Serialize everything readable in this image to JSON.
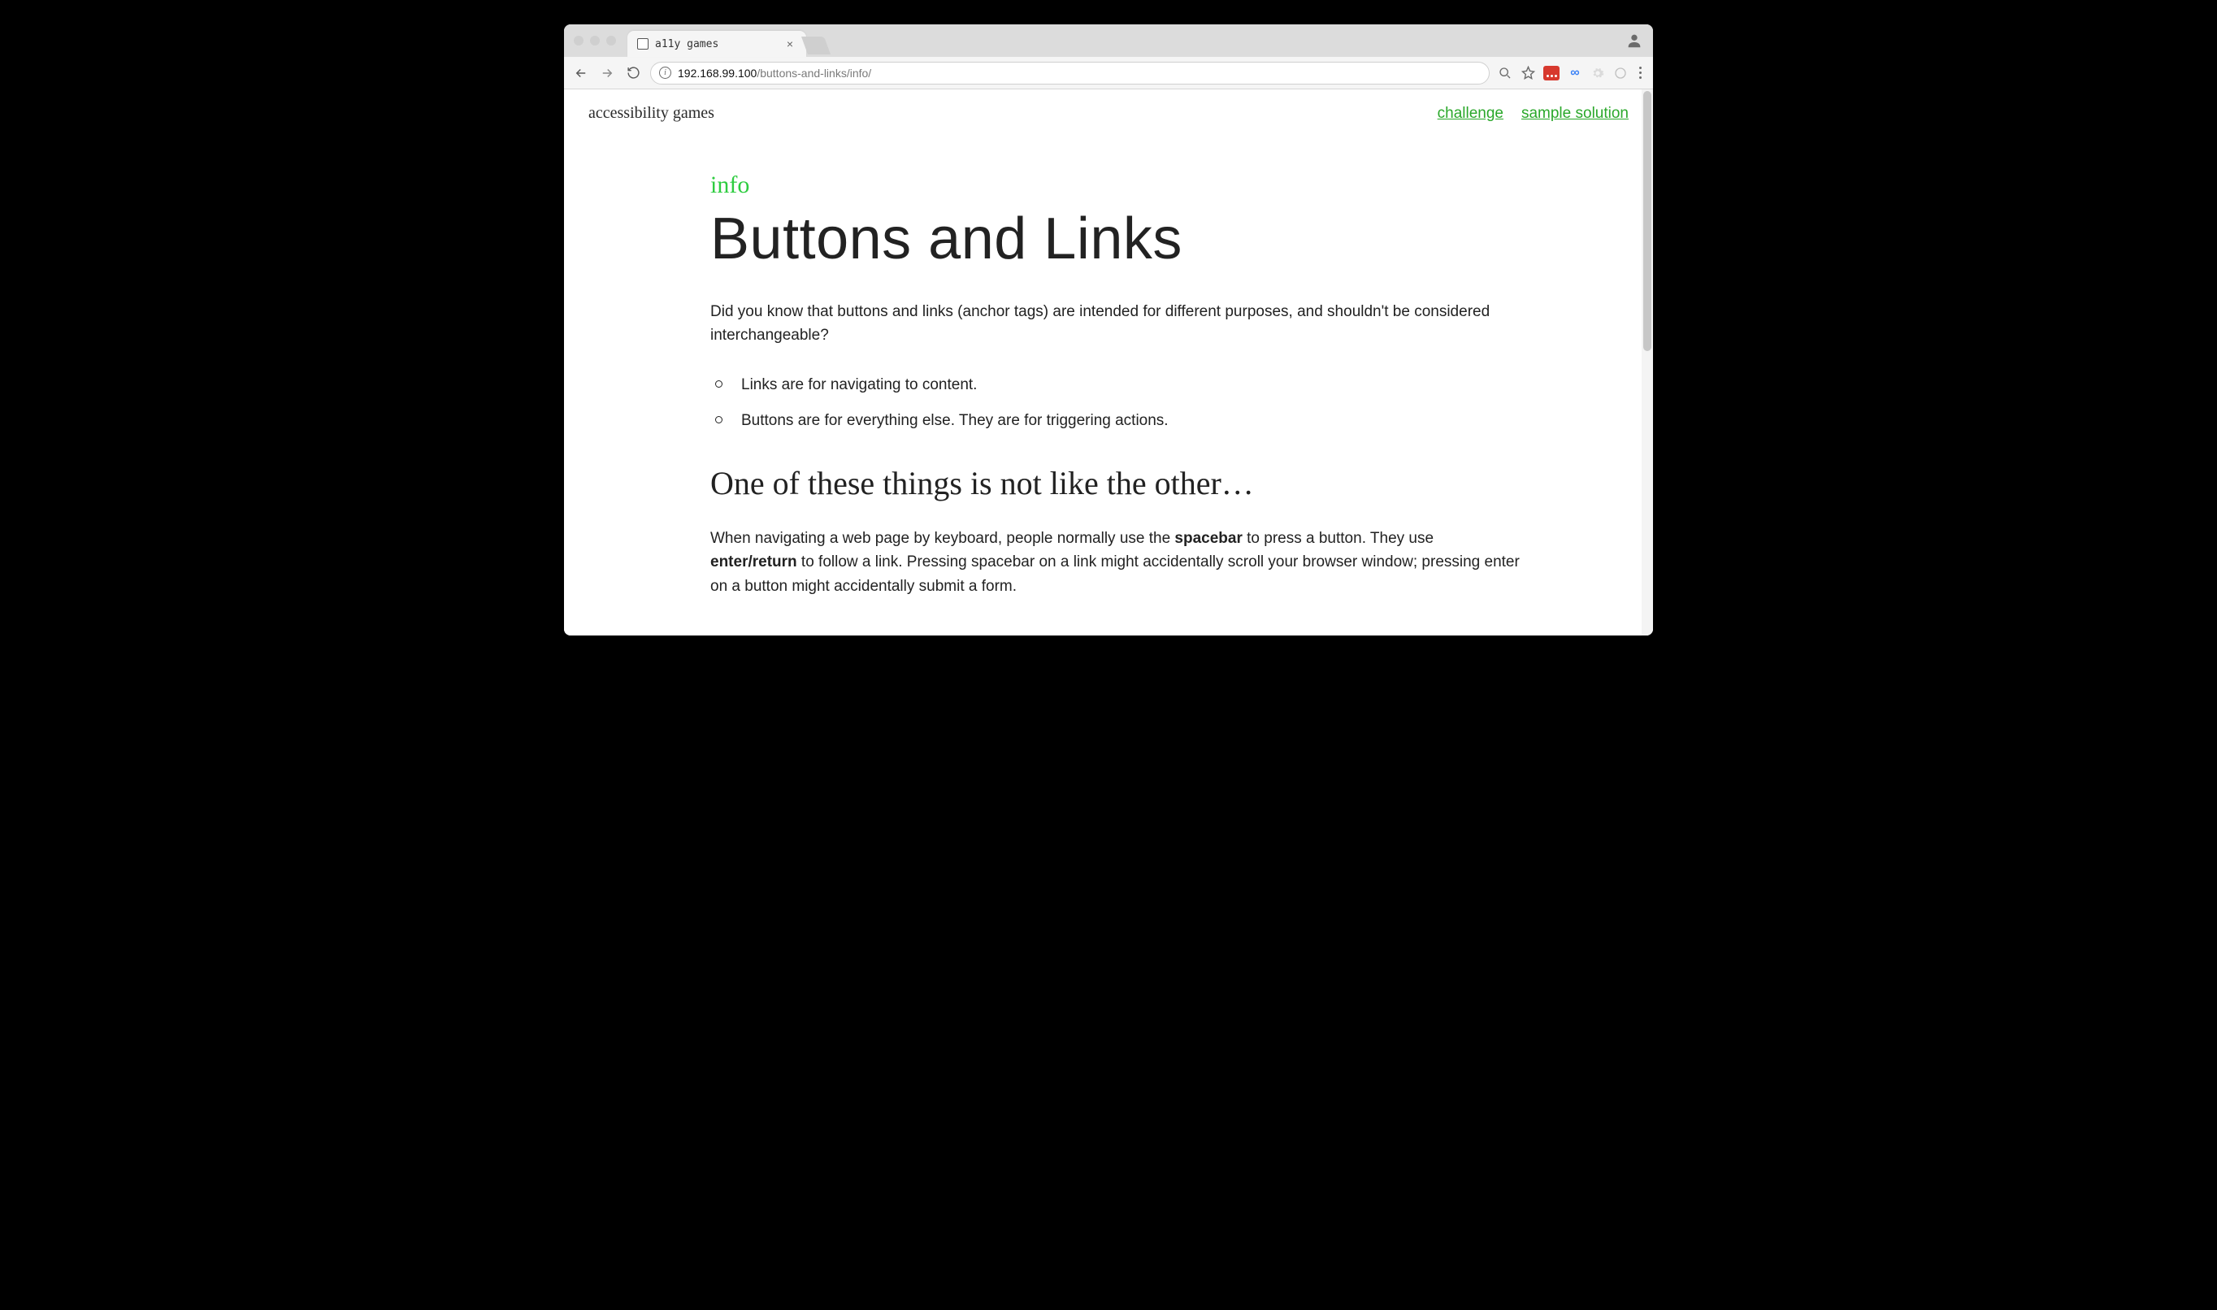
{
  "browser": {
    "tab_title": "a11y games",
    "url_host": "192.168.99.100",
    "url_path": "/buttons-and-links/info/"
  },
  "header": {
    "brand": "accessibility games",
    "nav": {
      "challenge": "challenge",
      "sample_solution": "sample solution"
    }
  },
  "article": {
    "kicker": "info",
    "title": "Buttons and Links",
    "intro": "Did you know that buttons and links (anchor tags) are intended for different purposes, and shouldn't be considered interchangeable?",
    "bullets": [
      "Links are for navigating to content.",
      "Buttons are for everything else. They are for triggering actions."
    ],
    "subheading": "One of these things is not like the other…",
    "p2_pre": "When navigating a web page by keyboard, people normally use the ",
    "p2_b1": "spacebar",
    "p2_mid1": " to press a button. They use ",
    "p2_b2": "enter/return",
    "p2_mid2": " to follow a link. Pressing spacebar on a link might accidentally scroll your browser window; pressing enter on a button might accidentally submit a form."
  }
}
